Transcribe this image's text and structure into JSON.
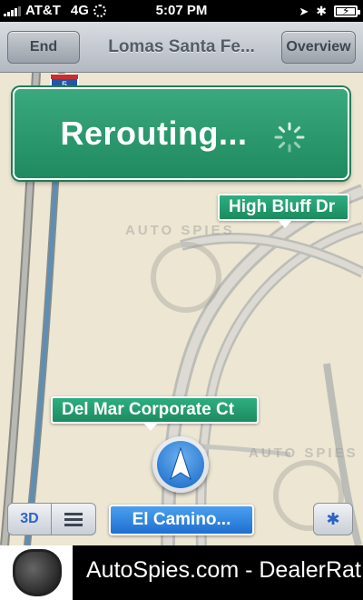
{
  "status_bar": {
    "carrier": "AT&T",
    "network": "4G",
    "time": "5:07 PM"
  },
  "nav_bar": {
    "end_label": "End",
    "title": "Lomas Santa Fe...",
    "overview_label": "Overview"
  },
  "map": {
    "highway_shield": "5",
    "watermark_text": "AUTO SPIES"
  },
  "reroute_banner": {
    "text": "Rerouting..."
  },
  "street_labels": {
    "high_bluff": "High Bluff Dr",
    "del_mar": "Del Mar Corporate Ct"
  },
  "bottom_controls": {
    "view_3d_label": "3D",
    "current_street": "El Camino..."
  },
  "footer": {
    "text": "AutoSpies.com - DealerRat"
  },
  "colors": {
    "sign_green": "#1f8a5f",
    "nav_blue": "#1f6fd0",
    "map_bg": "#ece6d2"
  }
}
